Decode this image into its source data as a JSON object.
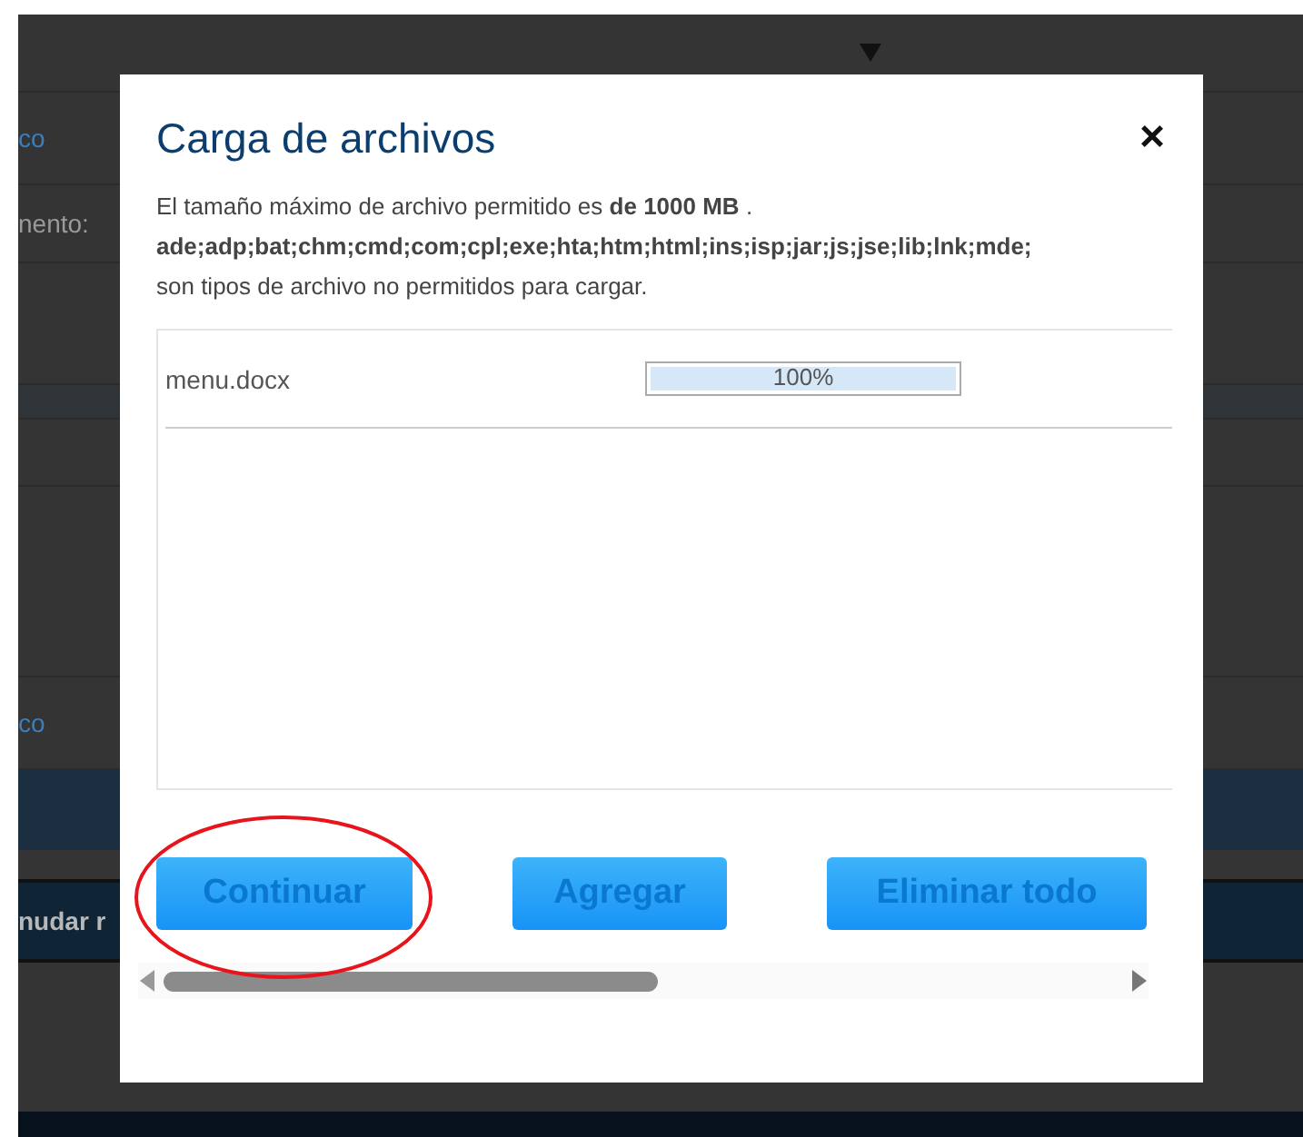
{
  "background_page": {
    "texts": [
      {
        "text": "co",
        "kind": "link"
      },
      {
        "text": "nento:",
        "kind": "label"
      },
      {
        "text": "co",
        "kind": "link"
      },
      {
        "text": "nudar r",
        "kind": "bar"
      }
    ]
  },
  "dialog": {
    "title": "Carga de archivos",
    "close": "×",
    "info": [
      "El tamaño máximo de archivo permitido es **de 1000 MB** .",
      "ade;adp;bat;chm;cmd;com;cpl;exe;hta;htm;html;ins;isp;jar;js;jse;lib;lnk;mde;",
      "son tipos de archivo no permitidos para cargar."
    ],
    "files": [
      {
        "name": "menu.docx",
        "level": 1,
        "reading": "100%"
      }
    ],
    "buttons": [
      {
        "label": "Continuar",
        "highlighted": true
      },
      {
        "label": "Agregar",
        "highlighted": false
      },
      {
        "label": "Eliminar todo",
        "highlighted": false
      }
    ]
  }
}
